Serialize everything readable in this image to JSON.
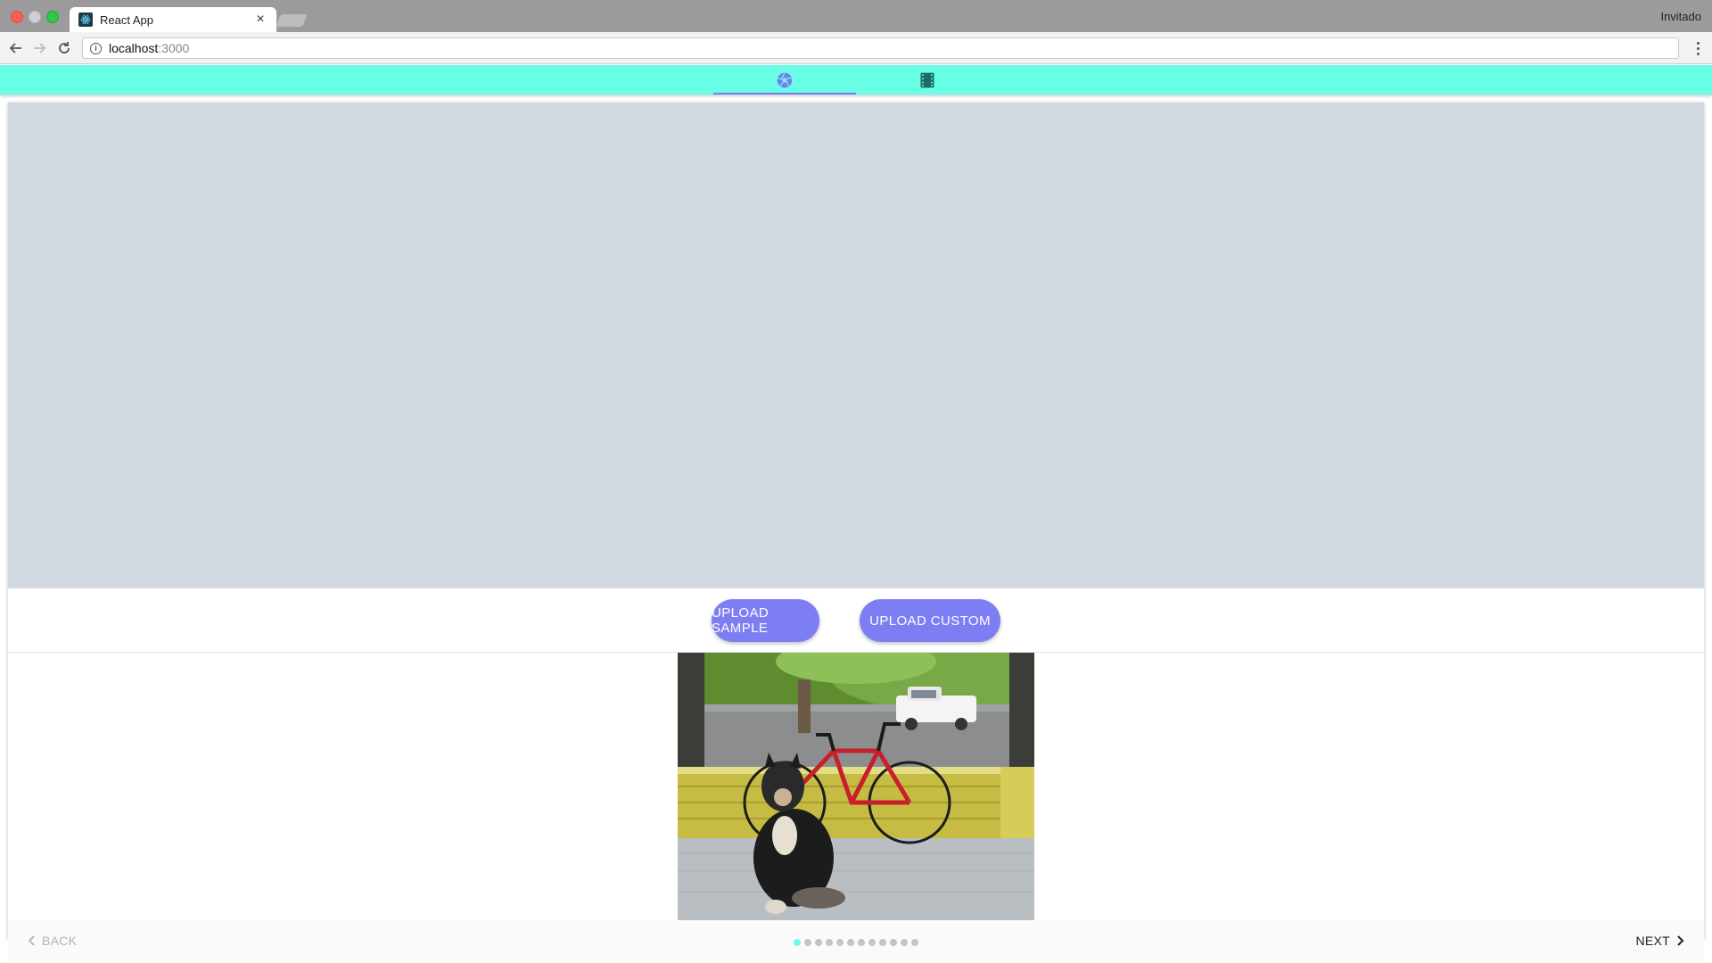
{
  "browser": {
    "tab_title": "React App",
    "tab_close": "×",
    "profile": "Invitado",
    "url_host": "localhost",
    "url_port": ":3000"
  },
  "appbar": {
    "tabs": [
      {
        "icon": "camera-aperture-icon",
        "selected": true
      },
      {
        "icon": "film-icon",
        "selected": false
      }
    ],
    "accent": "#69ffe6",
    "indicator_color": "#7a7af2"
  },
  "buttons": {
    "upload_sample": "UPLOAD SAMPLE",
    "upload_custom": "UPLOAD CUSTOM",
    "color": "#7e7ef4"
  },
  "stepper": {
    "back_label": "BACK",
    "next_label": "NEXT",
    "total_steps": 12,
    "active_step": 1
  }
}
